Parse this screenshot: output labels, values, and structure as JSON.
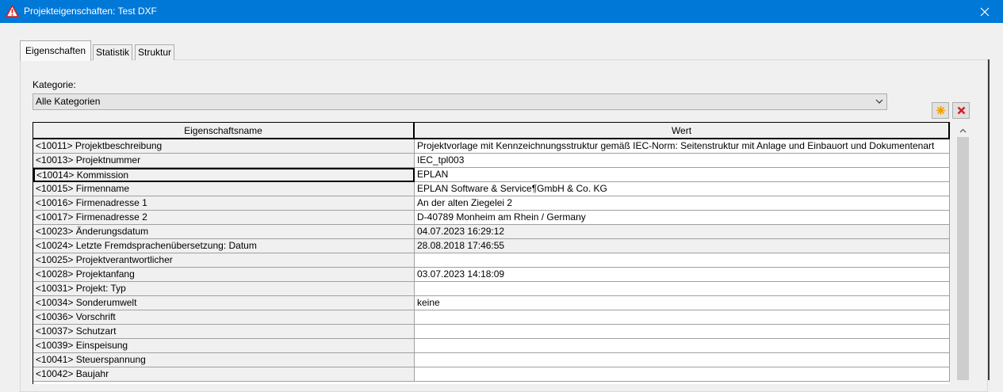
{
  "window": {
    "title": "Projekteigenschaften: Test DXF"
  },
  "tabs": [
    "Eigenschaften",
    "Statistik",
    "Struktur"
  ],
  "category": {
    "label": "Kategorie:",
    "selected": "Alle Kategorien"
  },
  "columns": {
    "name": "Eigenschaftsname",
    "value": "Wert"
  },
  "rows": [
    {
      "name": "<10011> Projektbeschreibung",
      "value": "Projektvorlage mit Kennzeichnungsstruktur gemäß IEC-Norm: Seitenstruktur mit Anlage und Einbauort und Dokumentenart"
    },
    {
      "name": "<10013> Projektnummer",
      "value": "IEC_tpl003"
    },
    {
      "name": "<10014> Kommission",
      "value": "EPLAN"
    },
    {
      "name": "<10015> Firmenname",
      "value": "EPLAN Software & Service¶GmbH & Co. KG"
    },
    {
      "name": "<10016> Firmenadresse 1",
      "value": "An der alten Ziegelei 2"
    },
    {
      "name": "<10017> Firmenadresse 2",
      "value": "D-40789 Monheim am Rhein / Germany"
    },
    {
      "name": "<10023> Änderungsdatum",
      "value": "04.07.2023 16:29:12"
    },
    {
      "name": "<10024> Letzte Fremdsprachenübersetzung: Datum",
      "value": "28.08.2018 17:46:55"
    },
    {
      "name": "<10025> Projektverantwortlicher",
      "value": ""
    },
    {
      "name": "<10028> Projektanfang",
      "value": "03.07.2023 14:18:09"
    },
    {
      "name": "<10031> Projekt: Typ",
      "value": ""
    },
    {
      "name": "<10034> Sonderumwelt",
      "value": "keine"
    },
    {
      "name": "<10036> Vorschrift",
      "value": ""
    },
    {
      "name": "<10037> Schutzart",
      "value": ""
    },
    {
      "name": "<10039> Einspeisung",
      "value": ""
    },
    {
      "name": "<10041> Steuerspannung",
      "value": ""
    },
    {
      "name": "<10042> Baujahr",
      "value": ""
    }
  ],
  "colors": {
    "titlebar": "#0078d7",
    "grid_line": "#a0a0a0",
    "readonly_cell": "#f0f0f0"
  }
}
